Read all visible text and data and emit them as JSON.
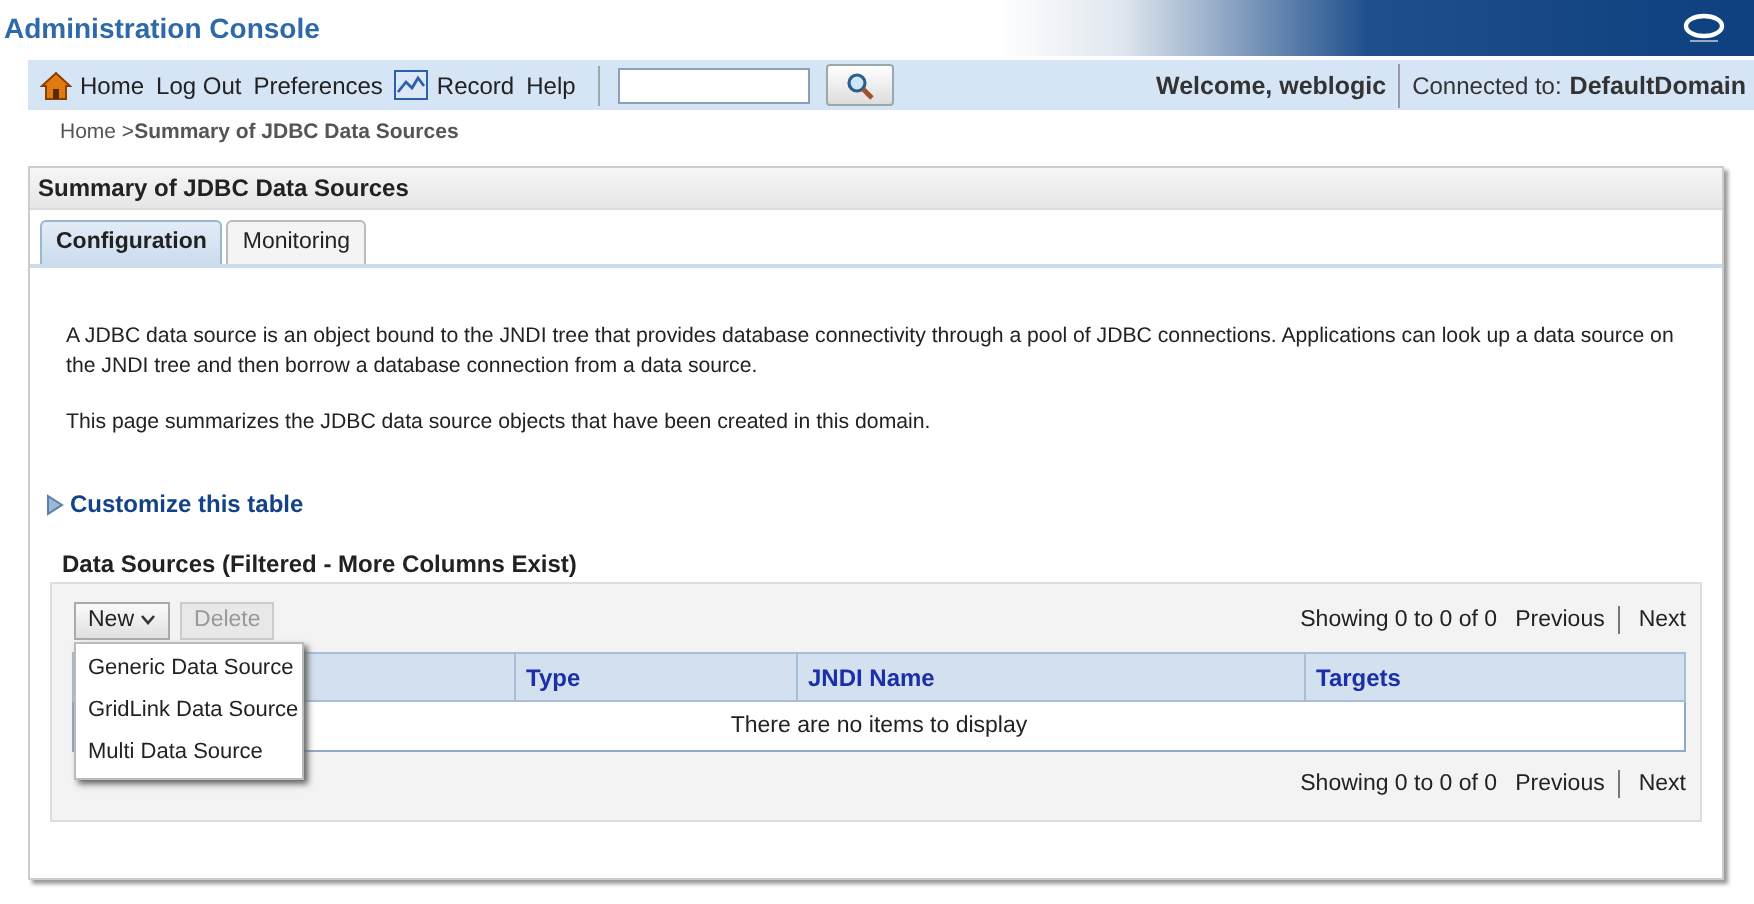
{
  "header": {
    "title": "Administration Console"
  },
  "toolbar": {
    "links": [
      {
        "label": "Home",
        "kind": "home"
      },
      {
        "label": "Log Out",
        "kind": "plain"
      },
      {
        "label": "Preferences",
        "kind": "plain"
      },
      {
        "label": "Record",
        "kind": "record"
      },
      {
        "label": "Help",
        "kind": "plain"
      }
    ],
    "welcome": "Welcome, weblogic",
    "connected_label": "Connected to:",
    "domain": "DefaultDomain"
  },
  "breadcrumb": {
    "home": "Home >",
    "current": "Summary of JDBC Data Sources"
  },
  "panel": {
    "title": "Summary of JDBC Data Sources",
    "tabs": [
      {
        "label": "Configuration",
        "selected": true
      },
      {
        "label": "Monitoring",
        "selected": false
      }
    ],
    "paragraphs": [
      "A JDBC data source is an object bound to the JNDI tree that provides database connectivity through a pool of JDBC connections. Applications can look up a data source on the JNDI tree and then borrow a database connection from a data source.",
      "This page summarizes the JDBC data source objects that have been created in this domain."
    ],
    "customize": "Customize this table",
    "table": {
      "title": "Data Sources (Filtered - More Columns Exist)",
      "new_button": {
        "label": "New",
        "expanded": true
      },
      "delete_button": {
        "label": "Delete",
        "disabled": true
      },
      "menu": [
        "Generic Data Source",
        "GridLink Data Source",
        "Multi Data Source"
      ],
      "pager_top": {
        "showing": "Showing 0 to 0 of 0",
        "previous": "Previous",
        "next": "Next"
      },
      "columns": [
        "Type",
        "JNDI Name",
        "Targets"
      ],
      "empty_message": "There are no items to display",
      "pager_bottom": {
        "showing": "Showing 0 to 0 of 0",
        "previous": "Previous",
        "next": "Next"
      }
    }
  }
}
